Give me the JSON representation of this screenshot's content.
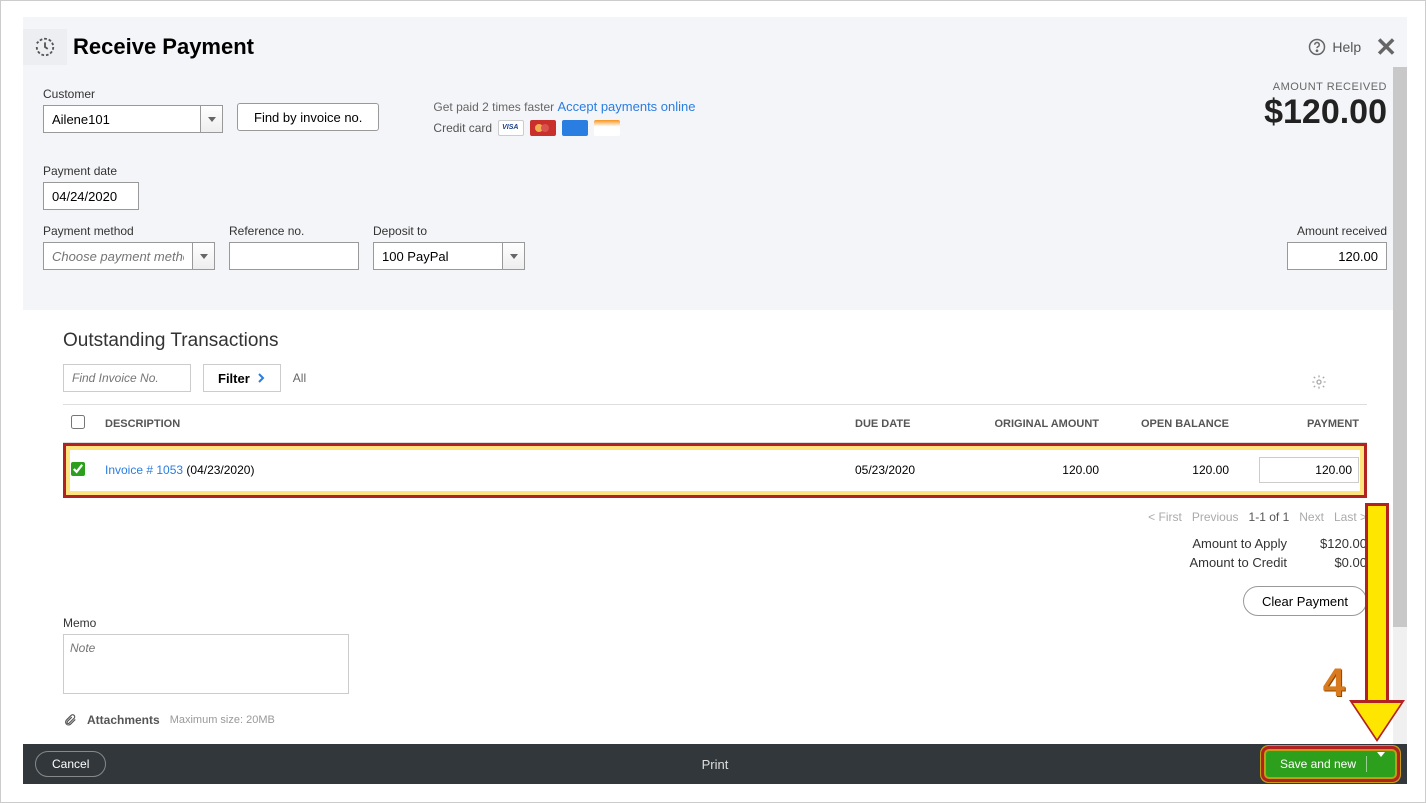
{
  "header": {
    "title": "Receive Payment",
    "help_label": "Help"
  },
  "customer": {
    "label": "Customer",
    "value": "Ailene101",
    "find_invoice_btn": "Find by invoice no."
  },
  "promo": {
    "prefix": "Get paid 2 times faster ",
    "link": "Accept payments online",
    "credit_card_label": "Credit card"
  },
  "amount_received": {
    "label": "AMOUNT RECEIVED",
    "value": "$120.00"
  },
  "payment_date": {
    "label": "Payment date",
    "value": "04/24/2020"
  },
  "payment_method": {
    "label": "Payment method",
    "placeholder": "Choose payment method"
  },
  "reference": {
    "label": "Reference no.",
    "value": ""
  },
  "deposit_to": {
    "label": "Deposit to",
    "value": "100 PayPal"
  },
  "amt_received_field": {
    "label": "Amount received",
    "value": "120.00"
  },
  "outstanding": {
    "title": "Outstanding Transactions",
    "search_placeholder": "Find Invoice No.",
    "filter_label": "Filter",
    "all_label": "All",
    "columns": {
      "description": "DESCRIPTION",
      "due_date": "DUE DATE",
      "original_amount": "ORIGINAL AMOUNT",
      "open_balance": "OPEN BALANCE",
      "payment": "PAYMENT"
    },
    "rows": [
      {
        "checked": true,
        "invoice_link": "Invoice # 1053",
        "invoice_date": " (04/23/2020)",
        "due_date": "05/23/2020",
        "original_amount": "120.00",
        "open_balance": "120.00",
        "payment": "120.00"
      }
    ],
    "pager": {
      "first": "< First",
      "previous": "Previous",
      "range": "1-1 of 1",
      "next": "Next",
      "last": "Last >"
    },
    "totals": {
      "apply_label": "Amount to Apply",
      "apply_value": "$120.00",
      "credit_label": "Amount to Credit",
      "credit_value": "$0.00"
    },
    "clear_btn": "Clear Payment"
  },
  "memo": {
    "label": "Memo",
    "placeholder": "Note"
  },
  "attachments": {
    "label": "Attachments",
    "max_size": "Maximum size: 20MB"
  },
  "footer": {
    "cancel": "Cancel",
    "print": "Print",
    "save": "Save and new"
  },
  "annotation": {
    "step": "4"
  }
}
